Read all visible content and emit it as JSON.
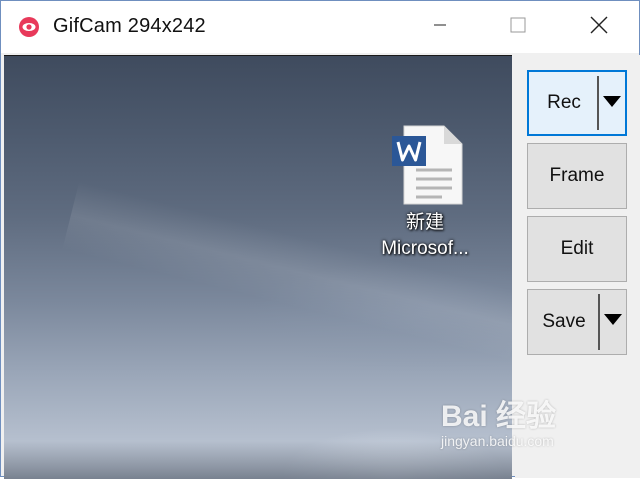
{
  "window": {
    "title": "GifCam 294x242",
    "app_icon": "gifcam-eye-icon",
    "controls": {
      "minimize_icon": "minimize-icon",
      "maximize_icon": "maximize-icon",
      "close_icon": "close-icon"
    },
    "accent_color": "#0078d7"
  },
  "capture": {
    "desktop_icon": {
      "icon": "word-document-icon",
      "label_line1": "新建",
      "label_line2": "Microsof..."
    }
  },
  "toolbar": {
    "rec_label": "Rec",
    "frame_label": "Frame",
    "edit_label": "Edit",
    "save_label": "Save",
    "dropdown_icon": "dropdown-arrow-icon"
  },
  "watermark": {
    "main": "Bai 经验",
    "sub": "jingyan.baidu.com"
  }
}
